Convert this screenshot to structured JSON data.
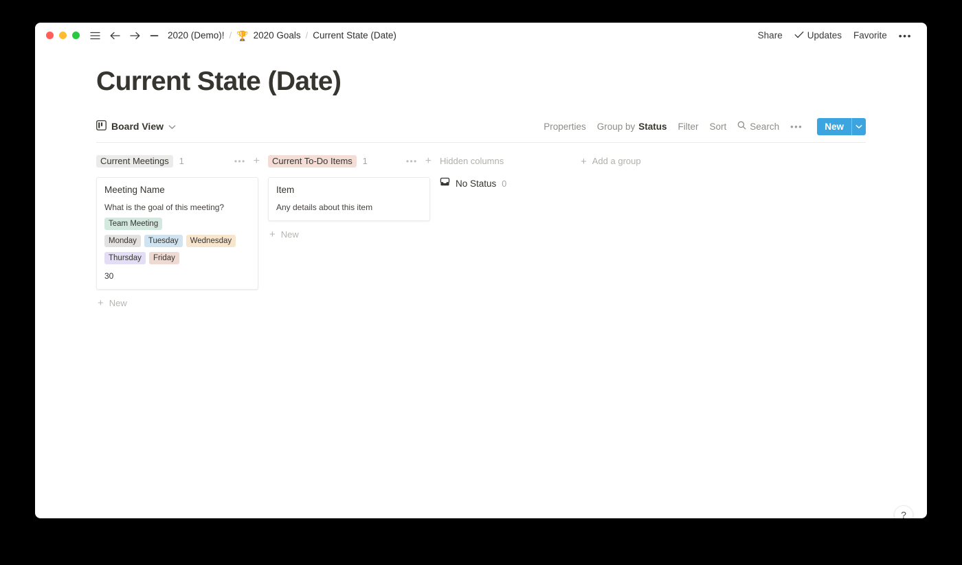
{
  "window": {
    "titlebar": {
      "traffic_lights": [
        {
          "name": "close",
          "color": "#ff5f57"
        },
        {
          "name": "minimize",
          "color": "#febc2e"
        },
        {
          "name": "maximize",
          "color": "#28c840"
        }
      ],
      "breadcrumb": [
        {
          "label": "2020 (Demo)!",
          "emoji": ""
        },
        {
          "label": "2020 Goals",
          "emoji": "🏆"
        },
        {
          "label": "Current State (Date)",
          "emoji": ""
        }
      ],
      "separator": "/",
      "actions": {
        "share": "Share",
        "updates": "Updates",
        "favorite": "Favorite",
        "more": "•••"
      }
    }
  },
  "page": {
    "title": "Current State (Date)"
  },
  "toolbar": {
    "view_name": "Board View",
    "properties": "Properties",
    "group_by_prefix": "Group by ",
    "group_by_value": "Status",
    "filter": "Filter",
    "sort": "Sort",
    "search": "Search",
    "more": "•••",
    "new_label": "New",
    "accent_color": "#3ca5e0"
  },
  "board": {
    "columns": [
      {
        "name": "Current Meetings",
        "pill_bg": "#ebebea",
        "count": "1",
        "menu": "•••",
        "add": "+",
        "new_label": "New",
        "cards": [
          {
            "title": "Meeting Name",
            "description": "What is the goal of this meeting?",
            "tag_groups": [
              [
                {
                  "label": "Team Meeting",
                  "bg": "#d3e9e0"
                }
              ],
              [
                {
                  "label": "Monday",
                  "bg": "#e3e2e0"
                },
                {
                  "label": "Tuesday",
                  "bg": "#cfe3f0"
                },
                {
                  "label": "Wednesday",
                  "bg": "#f8e5ce"
                }
              ],
              [
                {
                  "label": "Thursday",
                  "bg": "#e3ddf5"
                },
                {
                  "label": "Friday",
                  "bg": "#eed9d3"
                }
              ]
            ],
            "number": "30"
          }
        ]
      },
      {
        "name": "Current To-Do Items",
        "pill_bg": "#f4ddd6",
        "count": "1",
        "menu": "•••",
        "add": "+",
        "new_label": "New",
        "cards": [
          {
            "title": "Item",
            "description": "Any details about this item",
            "tag_groups": [],
            "number": ""
          }
        ]
      }
    ],
    "hidden_columns": {
      "title": "Hidden columns",
      "groups": [
        {
          "label": "No Status",
          "count": "0",
          "icon": "inbox-icon"
        }
      ]
    },
    "add_group_label": "Add a group"
  },
  "help": {
    "label": "?"
  }
}
